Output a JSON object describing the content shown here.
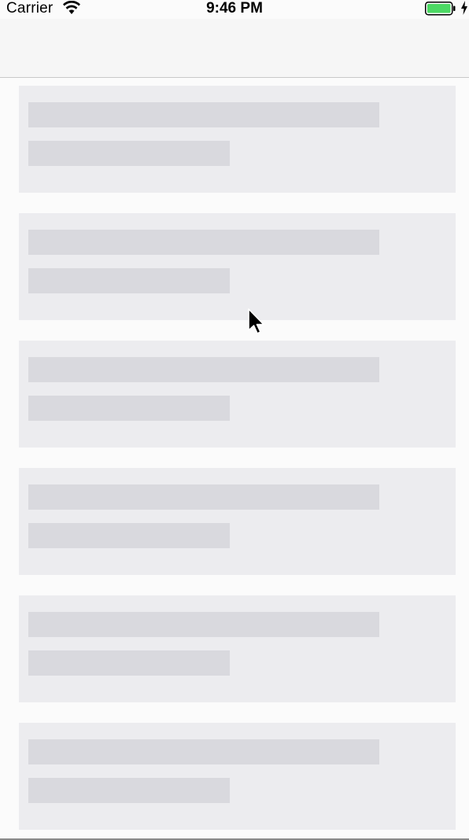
{
  "status_bar": {
    "carrier": "Carrier",
    "time": "9:46 PM",
    "wifi_icon": "wifi-icon",
    "battery_icon": "battery-icon",
    "charging_icon": "bolt-icon"
  },
  "colors": {
    "background": "#fbfbfb",
    "card": "#ececef",
    "placeholder": "#d9d9de",
    "battery_fill": "#4cd964"
  },
  "list": {
    "state": "loading",
    "placeholder_cards": 6
  },
  "cursor_icon": "mouse-pointer-icon"
}
